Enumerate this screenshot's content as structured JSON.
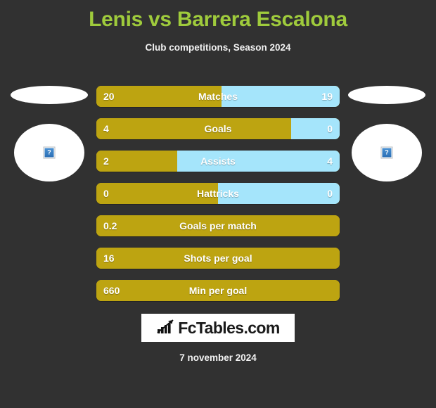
{
  "header": {
    "title": "Lenis vs Barrera Escalona",
    "subtitle": "Club competitions, Season 2024",
    "title_color": "#9fcb3c"
  },
  "colors": {
    "background": "#313131",
    "home_bar": "#bda411",
    "away_bar": "#a5e5fb",
    "title": "#9fcb3c",
    "text": "#ffffff"
  },
  "players": {
    "home": {
      "name": "",
      "photo_alt": "?",
      "side": "left"
    },
    "away": {
      "name": "",
      "photo_alt": "?",
      "side": "right"
    }
  },
  "stats": [
    {
      "label": "Matches",
      "home": "20",
      "away": "19",
      "home_pct": 51.3,
      "has_away": true
    },
    {
      "label": "Goals",
      "home": "4",
      "away": "0",
      "home_pct": 80.0,
      "has_away": true
    },
    {
      "label": "Assists",
      "home": "2",
      "away": "4",
      "home_pct": 33.3,
      "has_away": true
    },
    {
      "label": "Hattricks",
      "home": "0",
      "away": "0",
      "home_pct": 50.0,
      "has_away": true
    },
    {
      "label": "Goals per match",
      "home": "0.2",
      "away": "",
      "home_pct": 100,
      "has_away": false
    },
    {
      "label": "Shots per goal",
      "home": "16",
      "away": "",
      "home_pct": 100,
      "has_away": false
    },
    {
      "label": "Min per goal",
      "home": "660",
      "away": "",
      "home_pct": 100,
      "has_away": false
    }
  ],
  "logo": {
    "text": "FcTables.com",
    "icon": "bar-chart-growth-icon"
  },
  "footer": {
    "date": "7 november 2024"
  }
}
